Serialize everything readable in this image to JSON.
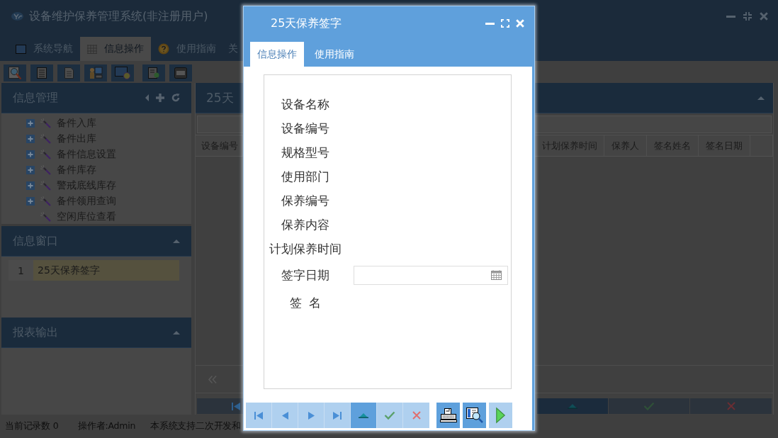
{
  "window": {
    "title": "设备维护保养管理系统(非注册用户)"
  },
  "tabs": [
    {
      "label": "系统导航",
      "kind": "monitor",
      "selected": false
    },
    {
      "label": "信息操作",
      "kind": "grid",
      "selected": true
    },
    {
      "label": "使用指南",
      "kind": "help",
      "selected": false
    },
    {
      "label": "关",
      "kind": "plain",
      "selected": false
    }
  ],
  "sidebar": {
    "info_management": {
      "title": "信息管理",
      "tree": [
        {
          "label": "备件入库",
          "kind": "branch"
        },
        {
          "label": "备件出库",
          "kind": "branch"
        },
        {
          "label": "备件信息设置",
          "kind": "branch"
        },
        {
          "label": "备件库存",
          "kind": "branch"
        },
        {
          "label": "警戒底线库存",
          "kind": "branch"
        },
        {
          "label": "备件领用查询",
          "kind": "branch"
        },
        {
          "label": "空闲库位查看",
          "kind": "leaf"
        }
      ]
    },
    "info_window": {
      "title": "信息窗口",
      "rows": [
        {
          "number": "1",
          "title": "25天保养签字",
          "selected": true
        }
      ]
    },
    "report_output": {
      "title": "报表输出"
    }
  },
  "main_panel": {
    "title": "25天",
    "table": {
      "columns": [
        "设备编号",
        "计划保养时间",
        "保养人",
        "签名姓名",
        "签名日期"
      ]
    },
    "nav_buttons": [
      {
        "kind": "first",
        "active": false
      },
      {
        "kind": "up",
        "active": true
      },
      {
        "kind": "confirm",
        "active": false
      },
      {
        "kind": "cancel",
        "active": false
      }
    ]
  },
  "status_bar": [
    "当前记录数 0",
    "操作者:Admin",
    "本系统支持二次开发和"
  ],
  "dialog": {
    "title": "25天保养签字",
    "tabs": [
      {
        "label": "信息操作",
        "selected": true
      },
      {
        "label": "使用指南",
        "selected": false
      }
    ],
    "form": {
      "fields": [
        {
          "label": "设备名称",
          "kind": "text"
        },
        {
          "label": "设备编号",
          "kind": "text"
        },
        {
          "label": "规格型号",
          "kind": "text"
        },
        {
          "label": "使用部门",
          "kind": "text"
        },
        {
          "label": "保养编号",
          "kind": "text"
        },
        {
          "label": "保养内容",
          "kind": "text"
        },
        {
          "label": "计划保养时间",
          "kind": "text"
        },
        {
          "label": "签字日期",
          "kind": "date"
        },
        {
          "label": "签  名",
          "kind": "text"
        }
      ]
    },
    "toolbar": [
      {
        "kind": "first",
        "active": false
      },
      {
        "kind": "prev",
        "active": false
      },
      {
        "kind": "next",
        "active": false
      },
      {
        "kind": "last",
        "active": false
      },
      {
        "kind": "up",
        "active": true
      },
      {
        "kind": "confirm",
        "active": false
      },
      {
        "kind": "cancel",
        "active": false
      },
      {
        "kind": "print",
        "active": true
      },
      {
        "kind": "preview",
        "active": true
      },
      {
        "kind": "run",
        "active": false
      }
    ]
  }
}
